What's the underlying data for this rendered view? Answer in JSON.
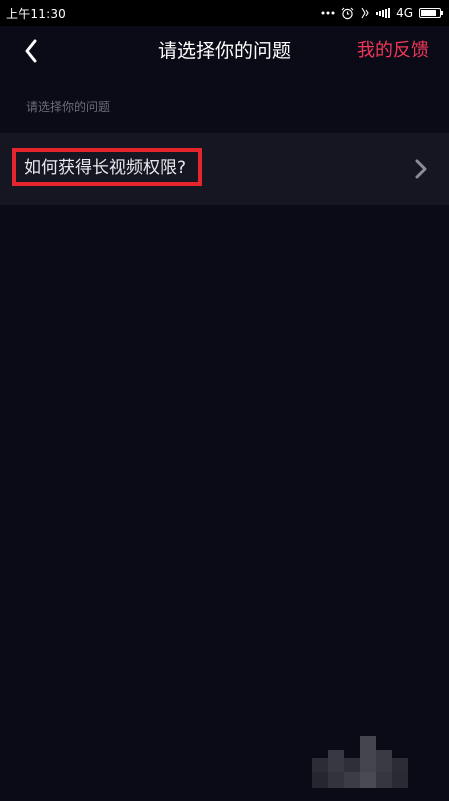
{
  "status_bar": {
    "time": "上午11:30",
    "network": "4G",
    "icons": [
      "more-dots-icon",
      "alarm-icon",
      "vibrate-icon",
      "signal-icon",
      "battery-icon"
    ]
  },
  "header": {
    "title": "请选择你的问题",
    "feedback_label": "我的反馈",
    "back_icon": "back-arrow-icon",
    "accent_color": "#f2365a"
  },
  "section": {
    "label": "请选择你的问题"
  },
  "questions": [
    {
      "text": "如何获得长视频权限?",
      "icon": "chevron-right-icon",
      "highlighted": true
    }
  ],
  "colors": {
    "background": "#0b0b17",
    "item_background": "#151622",
    "highlight_border": "#e5252c"
  }
}
